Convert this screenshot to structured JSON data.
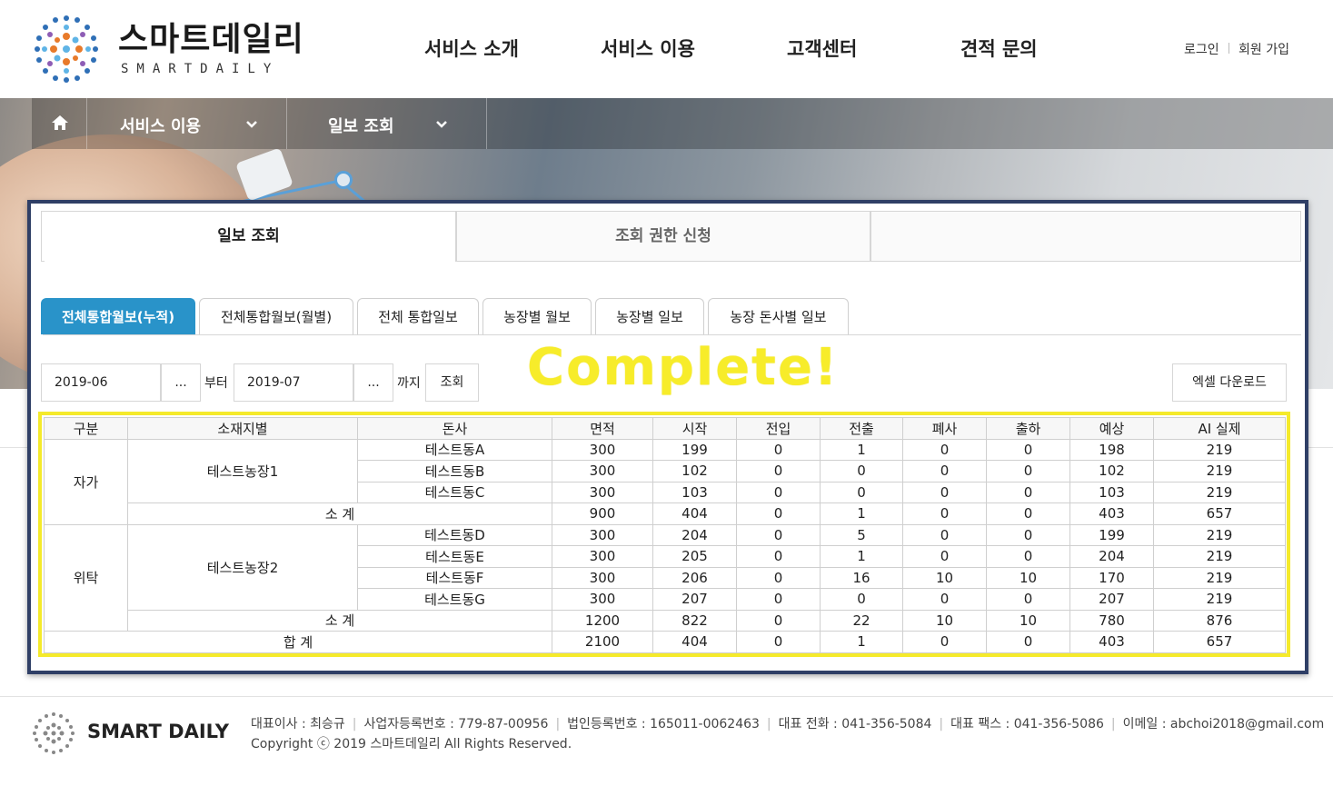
{
  "brand": {
    "name": "스마트데일리",
    "sub": "SMARTDAILY"
  },
  "gnb": [
    "서비스 소개",
    "서비스 이용",
    "고객센터",
    "견적 문의"
  ],
  "util": {
    "login": "로그인",
    "signup": "회원 가입"
  },
  "nav": {
    "item1": "서비스 이용",
    "item2": "일보 조회"
  },
  "top_tabs": [
    "일보 조회",
    "조회 권한 신청"
  ],
  "sub_tabs": [
    "전체통합월보(누적)",
    "전체통합월보(월별)",
    "전체 통합일보",
    "농장별 월보",
    "농장별 일보",
    "농장 돈사별 일보"
  ],
  "filter": {
    "from_value": "2019-06",
    "to_value": "2019-07",
    "ellipsis": "...",
    "from_label": "부터",
    "to_label": "까지",
    "search": "조회",
    "excel": "엑셀 다운로드"
  },
  "overlay_text": "Complete!",
  "table": {
    "headers": [
      "구분",
      "소재지별",
      "돈사",
      "면적",
      "시작",
      "전입",
      "전출",
      "폐사",
      "출하",
      "예상",
      "AI 실제"
    ],
    "group1": {
      "label": "자가",
      "farm": "테스트농장1"
    },
    "group2": {
      "label": "위탁",
      "farm": "테스트농장2"
    },
    "rows1": [
      [
        "테스트동A",
        "300",
        "199",
        "0",
        "1",
        "0",
        "0",
        "198",
        "219"
      ],
      [
        "테스트동B",
        "300",
        "102",
        "0",
        "0",
        "0",
        "0",
        "102",
        "219"
      ],
      [
        "테스트동C",
        "300",
        "103",
        "0",
        "0",
        "0",
        "0",
        "103",
        "219"
      ]
    ],
    "subtotal1": [
      "소        계",
      "900",
      "404",
      "0",
      "1",
      "0",
      "0",
      "403",
      "657"
    ],
    "rows2": [
      [
        "테스트동D",
        "300",
        "204",
        "0",
        "5",
        "0",
        "0",
        "199",
        "219"
      ],
      [
        "테스트동E",
        "300",
        "205",
        "0",
        "1",
        "0",
        "0",
        "204",
        "219"
      ],
      [
        "테스트동F",
        "300",
        "206",
        "0",
        "16",
        "10",
        "10",
        "170",
        "219"
      ],
      [
        "테스트동G",
        "300",
        "207",
        "0",
        "0",
        "0",
        "0",
        "207",
        "219"
      ]
    ],
    "subtotal2": [
      "소        계",
      "1200",
      "822",
      "0",
      "22",
      "10",
      "10",
      "780",
      "876"
    ],
    "total": [
      "합        계",
      "2100",
      "404",
      "0",
      "1",
      "0",
      "0",
      "403",
      "657"
    ]
  },
  "footer": {
    "name": "SMART DAILY",
    "ceo": "대표이사 : 최승규",
    "biz": "사업자등록번호 : 779-87-00956",
    "corp": "법인등록번호 : 165011-0062463",
    "tel": "대표 전화 : 041-356-5084",
    "fax": "대표 팩스 : 041-356-5086",
    "email": "이메일 : abchoi2018@gmail.com",
    "copyright": "Copyright ⓒ 2019 스마트데일리 All Rights Reserved."
  },
  "colors": {
    "accent": "#2993c9",
    "panel_border": "#2f3f66",
    "highlight": "#f5ea2b"
  }
}
